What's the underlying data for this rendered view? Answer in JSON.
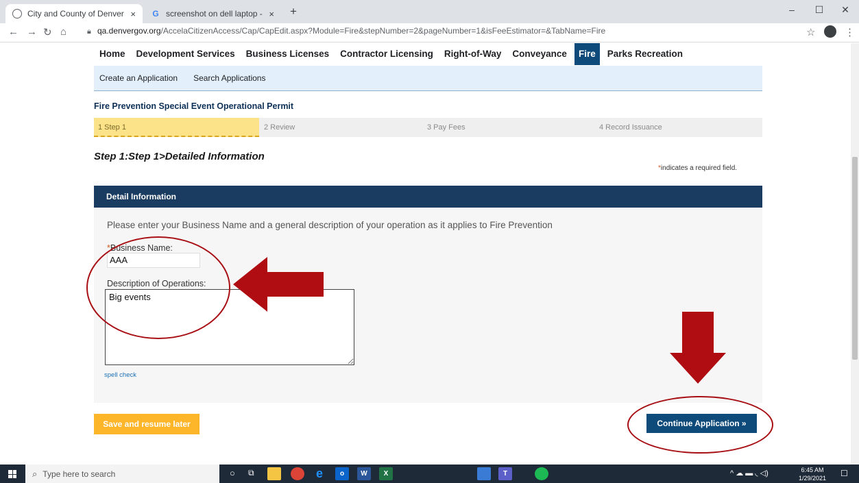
{
  "browser": {
    "tabs": [
      {
        "title": "City and County of Denver | ePer",
        "close": "×"
      },
      {
        "title": "screenshot on dell laptop - Goo",
        "close": "×"
      }
    ],
    "new_tab": "+",
    "url_host": "qa.denvergov.org",
    "url_path": "/AccelaCitizenAccess/Cap/CapEdit.aspx?Module=Fire&stepNumber=2&pageNumber=1&isFeeEstimator=&TabName=Fire"
  },
  "nav": {
    "items": [
      "Home",
      "Development Services",
      "Business Licenses",
      "Contractor Licensing",
      "Right-of-Way",
      "Conveyance",
      "Fire",
      "Parks Recreation"
    ],
    "active": "Fire"
  },
  "subnav": [
    "Create an Application",
    "Search Applications"
  ],
  "permit_title": "Fire Prevention Special Event Operational Permit",
  "steps": [
    "1 Step 1",
    "2 Review",
    "3 Pay Fees",
    "4 Record Issuance"
  ],
  "step_heading": "Step 1:Step 1>Detailed Information",
  "required_note": {
    "star": "*",
    "text": "indicates a required field."
  },
  "detail": {
    "header": "Detail Information",
    "instructions": "Please enter your Business Name and a general description of your operation as it applies to Fire Prevention",
    "business_name_label": "Business Name:",
    "business_name_value": "AAA",
    "description_label": "Description of Operations:",
    "description_value": "Big events",
    "spell_check": "spell check"
  },
  "buttons": {
    "save": "Save and resume later",
    "continue": "Continue Application »"
  },
  "taskbar": {
    "search_placeholder": "Type here to search",
    "time": "6:45 AM",
    "date": "1/29/2021"
  },
  "colors": {
    "nav_active": "#0e4b7a",
    "annotation_red": "#a80f14",
    "save_button": "#fdb52a",
    "detail_header": "#1b3c61"
  }
}
